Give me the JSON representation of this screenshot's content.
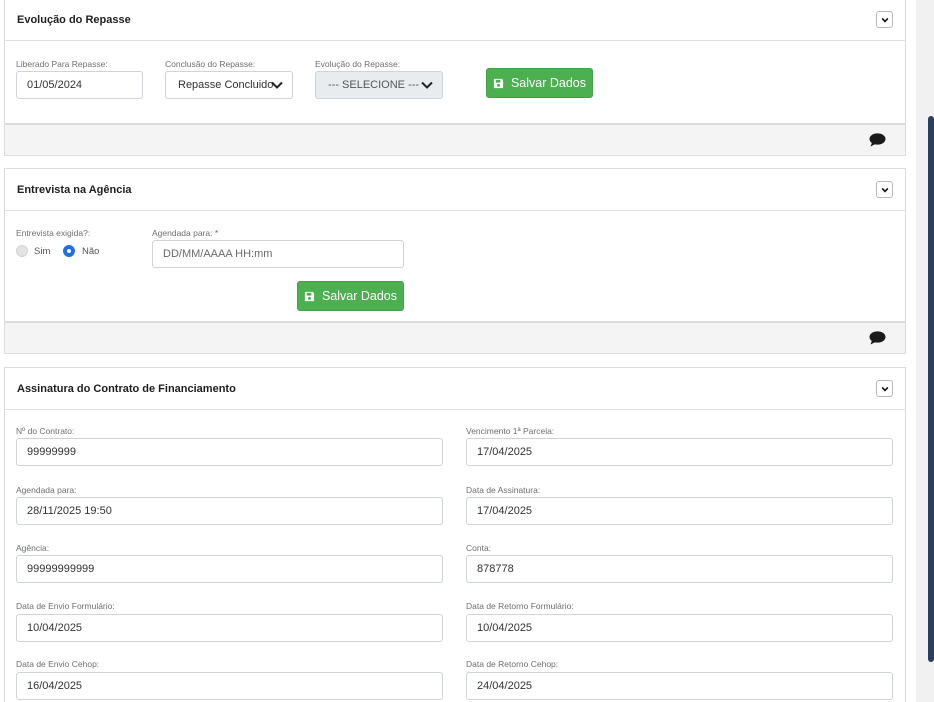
{
  "evolucao": {
    "title": "Evolução do Repasse",
    "liberado_label": "Liberado Para Repasse:",
    "liberado_value": "01/05/2024",
    "conclusao_label": "Conclusão do Repasse:",
    "conclusao_value": "Repasse Concluido",
    "evolucao_label": "Evolução do Repasse:",
    "evolucao_value": "--- SELECIONE ---",
    "save_label": "Salvar Dados"
  },
  "entrevista": {
    "title": "Entrevista na Agência",
    "exigida_label": "Entrevista exigida?:",
    "sim_label": "Sim",
    "nao_label": "Não",
    "agendada_label": "Agendada para:",
    "required_mark": "*",
    "agendada_placeholder": "DD/MM/AAAA HH:mm",
    "save_label": "Salvar Dados"
  },
  "assinatura": {
    "title": "Assinatura do Contrato de Financiamento",
    "fields": [
      {
        "label": "Nº do Contrato:",
        "value": "99999999"
      },
      {
        "label": "Vencimento 1ª Parcela:",
        "value": "17/04/2025"
      },
      {
        "label": "Agendada para:",
        "value": "28/11/2025 19:50"
      },
      {
        "label": "Data de Assinatura:",
        "value": "17/04/2025"
      },
      {
        "label": "Agência:",
        "value": "99999999999"
      },
      {
        "label": "Conta:",
        "value": "878778"
      },
      {
        "label": "Data de Envio Formulário:",
        "value": "10/04/2025"
      },
      {
        "label": "Data de Retorno Formulário:",
        "value": "10/04/2025"
      },
      {
        "label": "Data de Envio Cehop:",
        "value": "16/04/2025"
      },
      {
        "label": "Data de Retorno Cehop:",
        "value": "24/04/2025"
      }
    ]
  },
  "colors": {
    "success": "#4caf50",
    "radio_active": "#1e6fe8",
    "scrollbar_thumb": "#2c3e5e"
  },
  "icons": {
    "collapse": "chevron-down-icon",
    "save": "floppy-disk-icon",
    "comment": "comment-icon"
  }
}
